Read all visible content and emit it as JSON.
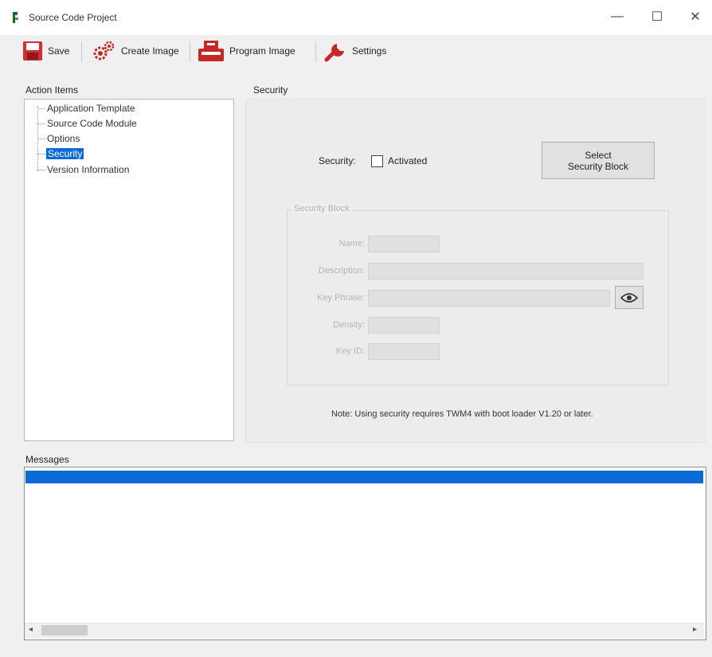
{
  "window": {
    "title": "Source Code Project",
    "controls": {
      "minimize": "—",
      "maximize": "☐",
      "close": "✕"
    }
  },
  "toolbar": {
    "save_label": "Save",
    "create_image_label": "Create Image",
    "program_image_label": "Program Image",
    "settings_label": "Settings"
  },
  "action_items": {
    "label": "Action Items",
    "items": [
      {
        "label": "Application Template"
      },
      {
        "label": "Source Code Module"
      },
      {
        "label": "Options"
      },
      {
        "label": "Security",
        "selected": true
      },
      {
        "label": "Version Information"
      }
    ]
  },
  "security": {
    "panel_label": "Security",
    "security_label": "Security:",
    "activated_label": "Activated",
    "activated": false,
    "select_block_label_line1": "Select",
    "select_block_label_line2": "Security Block",
    "block": {
      "title": "Security Block",
      "name_label": "Name:",
      "description_label": "Description:",
      "key_phrase_label": "Key Phrase:",
      "density_label": "Density:",
      "key_id_label": "Key ID:"
    },
    "note": "Note: Using security requires TWM4 with boot loader V1.20 or later."
  },
  "messages": {
    "label": "Messages",
    "scroll_left": "◂",
    "scroll_right": "▸"
  },
  "colors": {
    "accent": "#0a6ad6",
    "save_icon": "#d32f2f",
    "tool_red": "#c62828"
  }
}
